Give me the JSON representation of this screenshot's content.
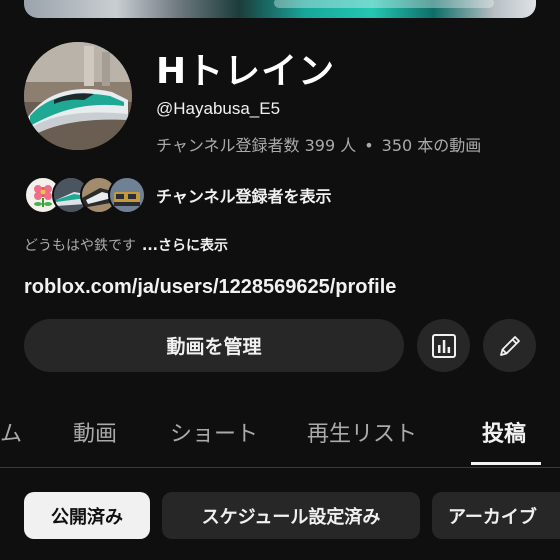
{
  "channel": {
    "name": "Hトレイン",
    "handle": "@Hayabusa_E5",
    "subscriber_count": "チャンネル登録者数 399 人",
    "separator": "•",
    "video_count": "350 本の動画"
  },
  "subscribers": {
    "show_label": "チャンネル登録者を表示",
    "avatar_icons": [
      "flower-avatar",
      "train-avatar",
      "train-avatar",
      "train-avatar"
    ]
  },
  "description": {
    "text": "どうもはや鉄です",
    "more_label": "...さらに表示"
  },
  "link": {
    "text": "roblox.com/ja/users/1228569625/profile"
  },
  "actions": {
    "manage_label": "動画を管理",
    "analytics_icon": "analytics-icon",
    "edit_icon": "pencil-icon"
  },
  "tabs": [
    {
      "label": "ム",
      "active": false
    },
    {
      "label": "動画",
      "active": false
    },
    {
      "label": "ショート",
      "active": false
    },
    {
      "label": "再生リスト",
      "active": false
    },
    {
      "label": "投稿",
      "active": true
    }
  ],
  "chips": [
    {
      "label": "公開済み",
      "selected": true
    },
    {
      "label": "スケジュール設定済み",
      "selected": false
    },
    {
      "label": "アーカイブ",
      "selected": false
    }
  ],
  "colors": {
    "background": "#0f0f0f",
    "surface": "#272727",
    "text_primary": "#f1f1f1",
    "text_secondary": "#aaaaaa",
    "train_accent": "#17a79b"
  }
}
